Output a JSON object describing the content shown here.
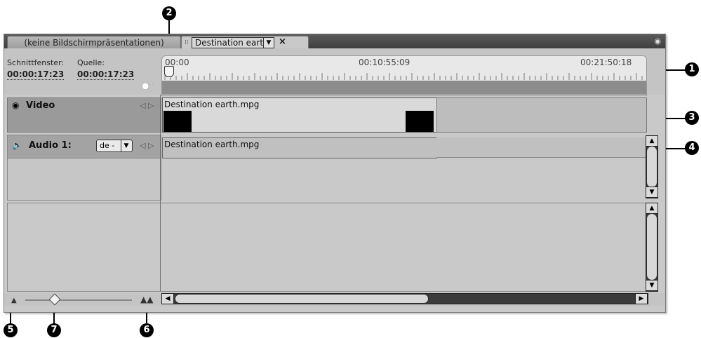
{
  "tabs": {
    "inactive_label": "(keine Bildschirmpräsentationen)",
    "active_label": "Destination earth",
    "dropdown_glyph": "▼",
    "close_glyph": "×",
    "panel_menu_glyph": "◉"
  },
  "header": {
    "schnittfenster_label": "Schnittfenster:",
    "quelle_label": "Quelle:",
    "schnittfenster_tc": "00:00:17:23",
    "quelle_tc": "00:00:17:23"
  },
  "ruler": {
    "start": "00:00",
    "mid": "00:10:55:09",
    "end": "00:21:50:18"
  },
  "tracks": {
    "video_label": "Video",
    "audio_label": "Audio 1:",
    "audio_lang": "de -",
    "audio_dd_glyph": "▼",
    "video_clip_name": "Destination earth.mpg",
    "audio_clip_name": "Destination earth.mpg"
  },
  "callouts": {
    "c1": "1",
    "c2": "2",
    "c3": "3",
    "c4": "4",
    "c5": "5",
    "c6": "6",
    "c7": "7"
  },
  "colors": {
    "panel_bg": "#c9c9c9",
    "tabbar_bg": "#3f3f3f",
    "clip_black": "#000000"
  }
}
